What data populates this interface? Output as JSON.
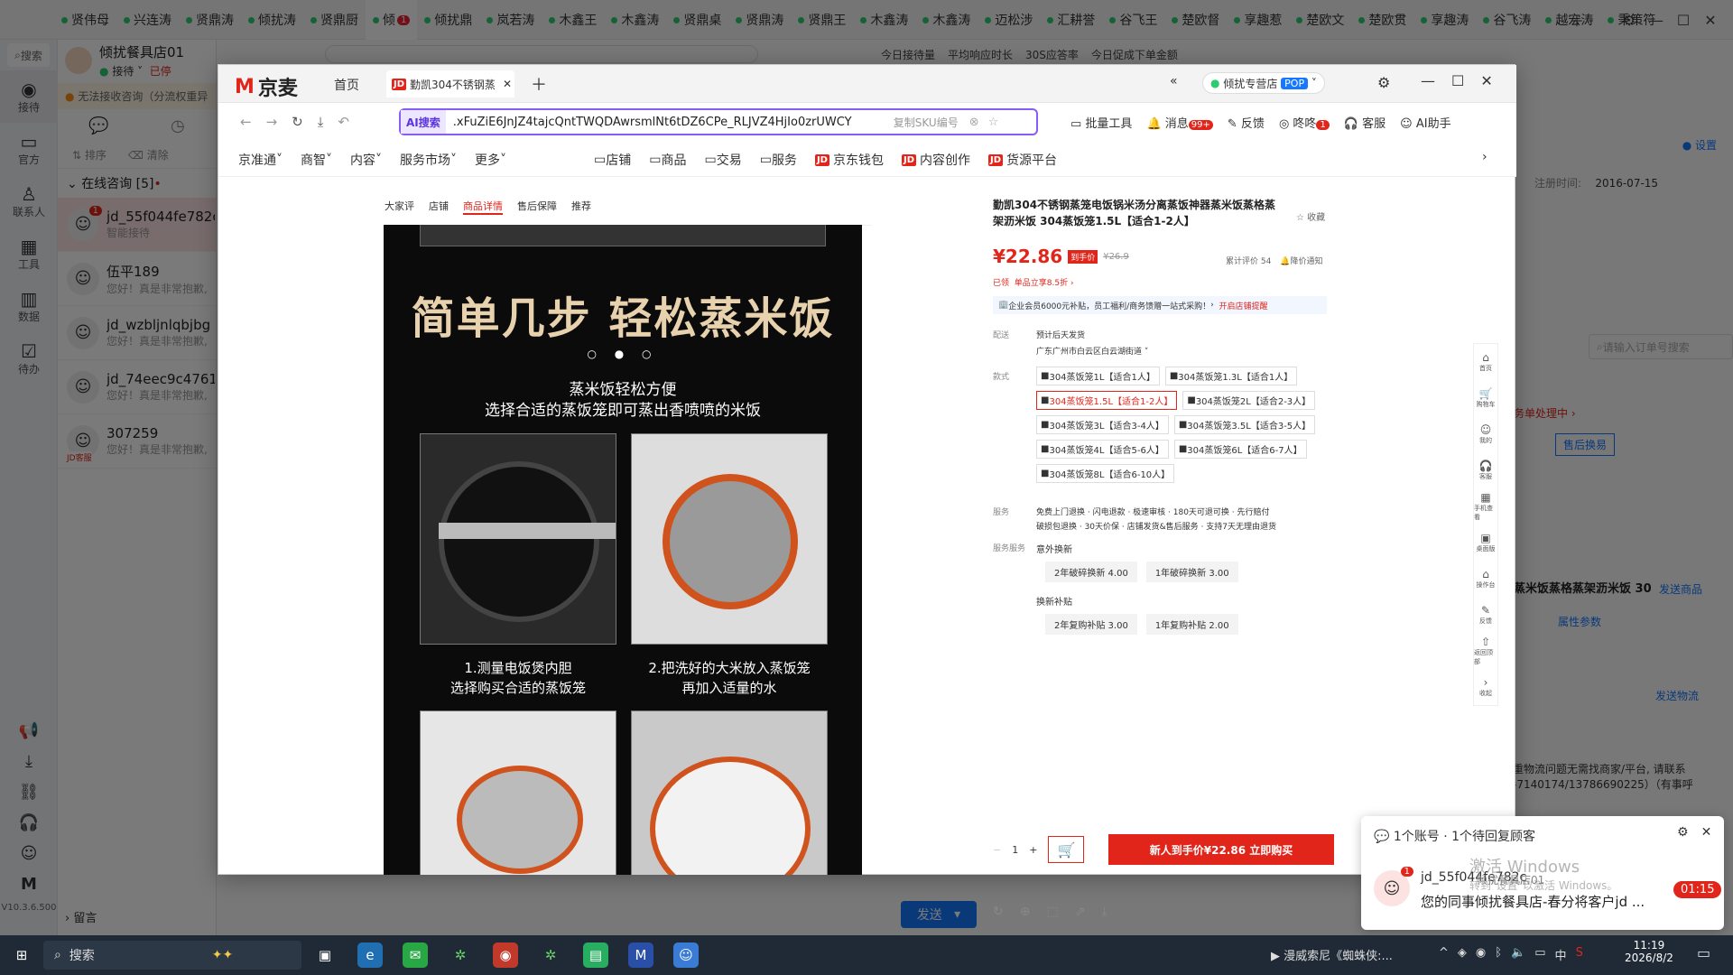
{
  "top_tabs": [
    "贤伟母",
    "兴连涛",
    "贤鼎涛",
    "倾扰涛",
    "贤鼎厨",
    "倾",
    "倾扰鼎",
    "岚若涛",
    "木鑫王",
    "木鑫涛",
    "贤鼎桌",
    "贤鼎涛",
    "贤鼎王",
    "木鑫涛",
    "木鑫涛",
    "迈松涉",
    "汇耕誉",
    "谷飞王",
    "楚欧督",
    "享趣惹",
    "楚欧文",
    "楚欧贯",
    "享趣涛",
    "谷飞涛",
    "越宏涛",
    "秉策符"
  ],
  "top_tab_badge": "1",
  "rail": {
    "search": "搜索",
    "items": [
      "接待",
      "官方",
      "联系人",
      "工具",
      "数据",
      "待办"
    ],
    "version": "V10.3.6.500"
  },
  "chat": {
    "store_name": "倾扰餐具店01",
    "status": "接待",
    "status2": "已停",
    "notice": "无法接收咨询（分流权重异",
    "sort": "排序",
    "clear": "清除",
    "section": "在线咨询 [5]",
    "rows": [
      {
        "name": "jd_55f044fe782c",
        "msg": "智能接待",
        "badge": "1"
      },
      {
        "name": "伍平189",
        "msg": "您好！真是非常抱歉,"
      },
      {
        "name": "jd_wzbljnlqbjbg",
        "msg": "您好！真是非常抱歉,"
      },
      {
        "name": "jd_74eec9c4761f",
        "msg": "您好！真是非常抱歉,"
      },
      {
        "name": "307259",
        "msg": "您好！真是非常抱歉,",
        "tag": "JD客服"
      }
    ],
    "leave_msg": "留言"
  },
  "bg_right": {
    "stats": [
      "今日接待量",
      "平均响应时长",
      "30S应答率",
      "今日促成下单金额"
    ],
    "register_label": "注册时间:",
    "register_date": "2016-07-15",
    "settings": "设置",
    "order_search": "请输入订单号搜索",
    "processing": "务单处理中",
    "btn_after": "售后换易",
    "product_title": "蒸米饭蒸格蒸架沥米饭 30",
    "send_product": "发送商品",
    "attr_params": "属性参数",
    "send_logistics": "发送物流",
    "logistics_text1": "重物流问题无需找商家/平台, 请联系",
    "logistics_text2": "-7140174/13786690225）（有事呼",
    "send_btn": "发送"
  },
  "window": {
    "logo": "京麦",
    "tab_home": "首页",
    "tab_active": "勤凯304不锈钢蒸",
    "store_badge": "倾扰专营店",
    "pop": "POP",
    "ai_search": "AI搜索",
    "url": ".xFuZiE6JnJZ4tajcQntTWQDAwrsmlNt6tDZ6CPe_RLJVZ4HjIo0zrUWCY",
    "copy_sku": "复制SKU编号",
    "toolbar": {
      "batch": "批量工具",
      "msg": "消息",
      "msg_badge": "99+",
      "feedback": "反馈",
      "dingdong": "咚咚",
      "dingdong_badge": "1",
      "service": "客服",
      "ai": "AI助手"
    },
    "nav": [
      "京准通",
      "商智",
      "内容",
      "服务市场",
      "更多"
    ],
    "nav2": [
      "店铺",
      "商品",
      "交易",
      "服务",
      "京东钱包",
      "内容创作",
      "货源平台"
    ]
  },
  "product_tabs": [
    "大家评",
    "店铺",
    "商品详情",
    "售后保障",
    "推荐"
  ],
  "product_image": {
    "headline": "简单几步 轻松蒸米饭",
    "sub1": "蒸米饭轻松方便",
    "sub2": "选择合适的蒸饭笼即可蒸出香喷喷的米饭",
    "step1a": "1.测量电饭煲内胆",
    "step1b": "选择购买合适的蒸饭笼",
    "step2a": "2.把洗好的大米放入蒸饭笼",
    "step2b": "再加入适量的水"
  },
  "detail": {
    "title": "勤凯304不锈钢蒸笼电饭锅米汤分离蒸饭神器蒸米饭蒸格蒸架沥米饭 304蒸饭笼1.5L【适合1-2人】",
    "fav": "收藏",
    "price": "¥22.86",
    "price_tag": "到手价",
    "orig_price": "¥26.9",
    "review": "累计评价 54",
    "notify": "降价通知",
    "coupon_label": "已领",
    "coupon": "单品立享8.5折",
    "enterprise": "企业会员6000元补贴，员工福利/商务馈赠一站式采购！",
    "open_vip": "开启店铺提醒",
    "ship_label": "配送",
    "ship_value": "预计后天发货",
    "ship_addr": "广东广州市白云区白云湖街道",
    "style_label": "款式",
    "options": [
      "304蒸饭笼1L【适合1人】",
      "304蒸饭笼1.3L【适合1人】",
      "304蒸饭笼1.5L【适合1-2人】",
      "304蒸饭笼2L【适合2-3人】",
      "304蒸饭笼3L【适合3-4人】",
      "304蒸饭笼3.5L【适合3-5人】",
      "304蒸饭笼4L【适合5-6人】",
      "304蒸饭笼6L【适合6-7人】",
      "304蒸饭笼8L【适合6-10人】"
    ],
    "selected_option": 2,
    "service_label": "服务",
    "service_text1": "免费上门退换 · 闪电退款 · 极速审核 · 180天可退可换 · 先行赔付",
    "service_text2": "破损包退换 · 30天价保 · 店铺发货&售后服务 · 支持7天无理由退货",
    "extra_label": "服务服务",
    "extra1": "意外换新",
    "extra1_opts": [
      "2年破碎换新 4.00",
      "1年破碎换新 3.00"
    ],
    "extra2": "换新补贴",
    "extra2_opts": [
      "2年复购补贴 3.00",
      "1年复购补贴 2.00"
    ],
    "qty": "1",
    "buy_btn": "新人到手价¥22.86 立即购买"
  },
  "side_icons": [
    "首页",
    "购物车",
    "我的",
    "客服",
    "手机查看",
    "桌面版",
    "操作台",
    "反馈",
    "返回顶部",
    "收起"
  ],
  "popup": {
    "title": "1个账号 · 1个待回复顾客",
    "user": "jd_55f044fe782c",
    "store": "倾扰餐具店01",
    "msg": "您的同事倾扰餐具店-春分将客户jd ...",
    "time": "01:15",
    "badge": "1",
    "win_activate": "激活 Windows",
    "win_activate2": "转到\"设置\"以激活 Windows。"
  },
  "taskbar": {
    "search": "搜索",
    "media": "漫威索尼《蜘蛛侠:...",
    "ime": "中",
    "time": "11:19",
    "date": "2026/8/2"
  },
  "colors": {
    "jd_red": "#e1251b",
    "accent_blue": "#1677ff",
    "green": "#2ecc71"
  }
}
